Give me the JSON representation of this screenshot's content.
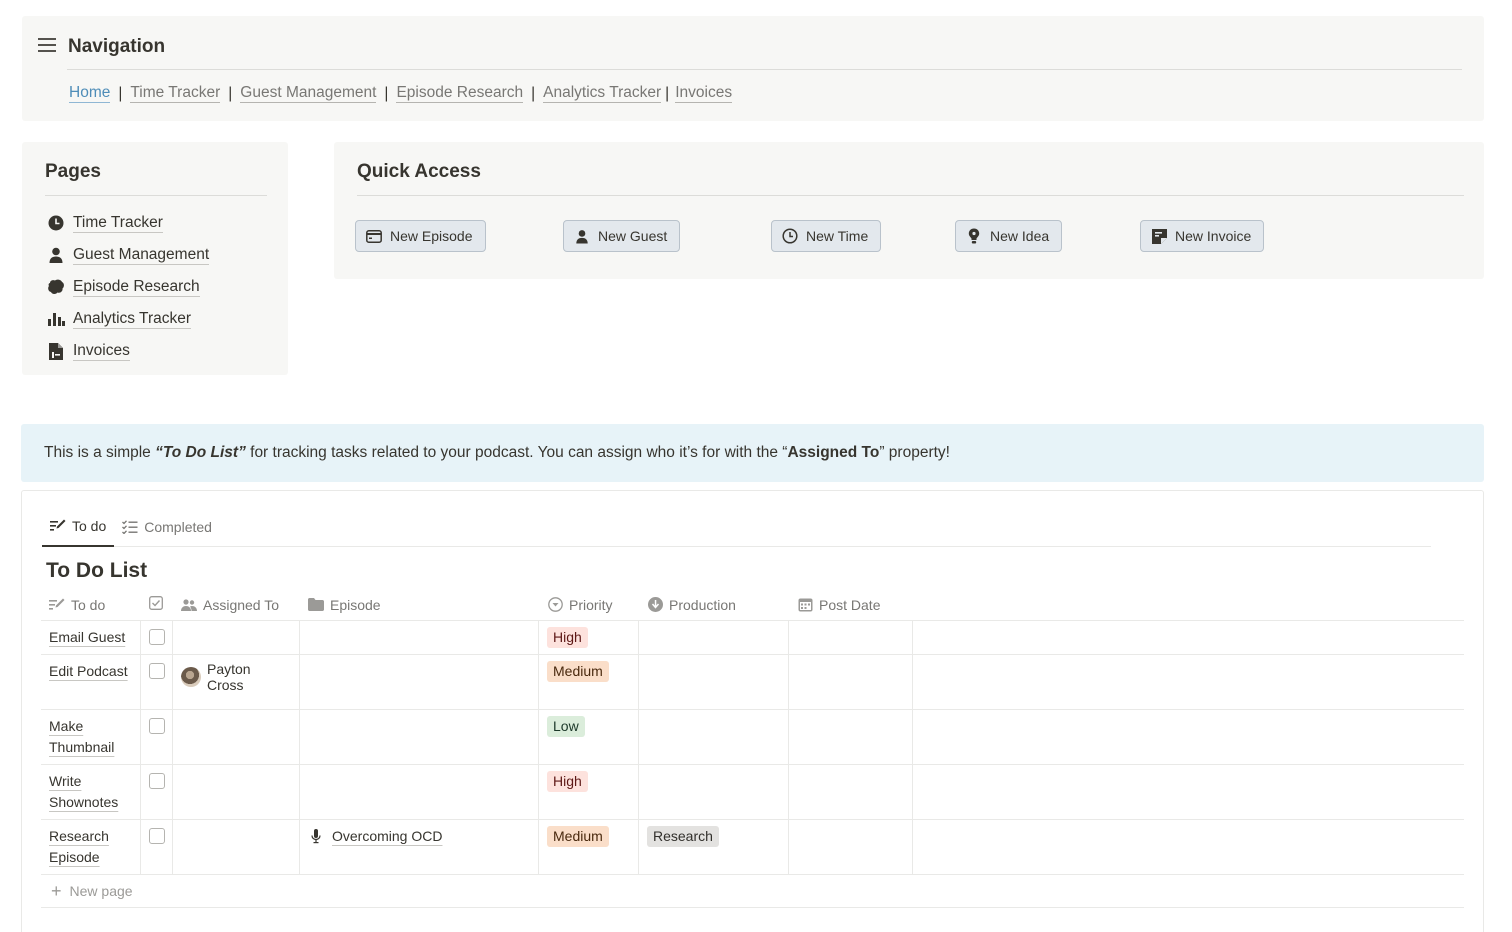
{
  "navigation": {
    "title": "Navigation",
    "links": [
      {
        "label": "Home"
      },
      {
        "label": "Time Tracker"
      },
      {
        "label": "Guest Management"
      },
      {
        "label": "Episode Research"
      },
      {
        "label": "Analytics Tracker"
      },
      {
        "label": "Invoices"
      }
    ],
    "separator": "|"
  },
  "pages": {
    "title": "Pages",
    "items": [
      {
        "label": "Time Tracker",
        "icon": "clock-icon"
      },
      {
        "label": "Guest Management",
        "icon": "person-icon"
      },
      {
        "label": "Episode Research",
        "icon": "brain-icon"
      },
      {
        "label": "Analytics Tracker",
        "icon": "bar-chart-icon"
      },
      {
        "label": "Invoices",
        "icon": "document-icon"
      }
    ]
  },
  "quick_access": {
    "title": "Quick Access",
    "buttons": [
      {
        "label": "New Episode",
        "icon": "calendar-card-icon"
      },
      {
        "label": "New Guest",
        "icon": "person-icon"
      },
      {
        "label": "New Time",
        "icon": "clock-icon"
      },
      {
        "label": "New Idea",
        "icon": "lightbulb-icon"
      },
      {
        "label": "New Invoice",
        "icon": "note-icon"
      }
    ]
  },
  "callout": {
    "part1": "This is a simple ",
    "quoted": "“To Do List”",
    "part2": " for tracking tasks related to your podcast. You can assign who it’s for with the “",
    "bold": "Assigned To",
    "part3": "” property!"
  },
  "tabs": [
    {
      "label": "To do",
      "active": true
    },
    {
      "label": "Completed",
      "active": false
    }
  ],
  "database": {
    "title": "To Do List",
    "columns": [
      "To do",
      "",
      "Assigned To",
      "Episode",
      "Priority",
      "Production",
      "Post Date"
    ],
    "rows": [
      {
        "todo": "Email Guest",
        "done": false,
        "assigned": "",
        "episode": "",
        "priority": "High",
        "production": "",
        "post_date": ""
      },
      {
        "todo": "Edit Podcast",
        "done": false,
        "assigned": "Payton Cross",
        "episode": "",
        "priority": "Medium",
        "production": "",
        "post_date": ""
      },
      {
        "todo": "Make Thumbnail",
        "done": false,
        "assigned": "",
        "episode": "",
        "priority": "Low",
        "production": "",
        "post_date": ""
      },
      {
        "todo": "Write Shownotes",
        "done": false,
        "assigned": "",
        "episode": "",
        "priority": "High",
        "production": "",
        "post_date": ""
      },
      {
        "todo": "Research Episode",
        "done": false,
        "assigned": "",
        "episode": "Overcoming OCD",
        "priority": "Medium",
        "production": "Research",
        "post_date": ""
      }
    ],
    "new_page_label": "New page"
  },
  "colors": {
    "card_bg": "#f7f7f5",
    "callout_bg": "#e7f3f8",
    "button_bg": "#e3e8ed",
    "high": "#fde2dd",
    "medium": "#fadec9",
    "low": "#dbeddb",
    "research": "#e3e2e0"
  }
}
